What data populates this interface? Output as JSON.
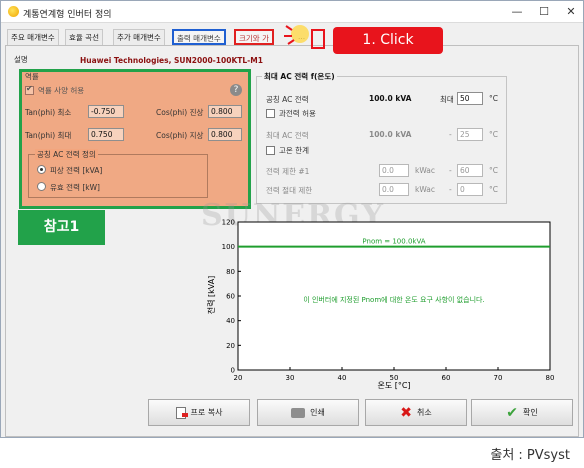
{
  "window": {
    "title": "계통연계형 인버터 정의",
    "controls": [
      "—",
      "☐",
      "✕"
    ]
  },
  "tabs": [
    "주요 매개변수",
    "효율 곡선",
    "추가 매개변수",
    "출력 매개변수",
    "크기와 가",
    "..."
  ],
  "description": {
    "label": "설명",
    "value": "Huawei Technologies, SUN2000-100KTL-M1"
  },
  "reactive": {
    "section": "역률",
    "allow_label": "역률 사양 허용",
    "tanphi_min_label": "Tan(phi) 최소",
    "tanphi_min": "-0.750",
    "cosphi_lead_label": "Cos(phi) 진상",
    "cosphi_lead": "0.800",
    "tanphi_max_label": "Tan(phi) 최대",
    "tanphi_max": "0.750",
    "cosphi_lag_label": "Cos(phi) 지상",
    "cosphi_lag": "0.800",
    "group_title": "공칭 AC 전력 정의",
    "option_apparent": "피상 전력 [kVA]",
    "option_active": "유효 전력 [kW]"
  },
  "ac_power": {
    "title": "최대 AC 전력 f(온도)",
    "nominal_label": "공칭 AC 전력",
    "nominal_value": "100.0 kVA",
    "max_label": "최대",
    "max_temp": "50",
    "unit_c": "°C",
    "overpower_label": "과전력 허용",
    "max_ac_label": "최대 AC 전력",
    "max_ac_value": "100.0 kVA",
    "max_ac_temp": "25",
    "high_temp_label": "고온 한계",
    "limit1_label": "전력 제한 #1",
    "limit1_value": "0.0",
    "limit1_unit": "kWac",
    "limit1_temp": "60",
    "abs_limit_label": "전력 절대 제한",
    "abs_limit_value": "0.0",
    "abs_limit_unit": "kWac",
    "abs_limit_temp": "0",
    "dash": "-"
  },
  "chart_data": {
    "type": "line",
    "xlabel": "온도 [°C]",
    "ylabel": "전력 [kVA]",
    "xlim": [
      20,
      80
    ],
    "ylim": [
      0,
      120
    ],
    "xticks": [
      20,
      30,
      40,
      50,
      60,
      70,
      80
    ],
    "yticks": [
      0,
      20,
      40,
      60,
      80,
      100,
      120
    ],
    "series": [
      {
        "name": "Pnom = 100.0kVA",
        "x": [
          20,
          80
        ],
        "y": [
          100,
          100
        ],
        "color": "#1f9e2e"
      }
    ],
    "annotation": "이 인버터에 지정된 Pnom에 대한 온도 요구 사항이 없습니다."
  },
  "overlay": {
    "ref_badge": "참고1",
    "click_badge": "1. Click",
    "watermark": "SUNERGY"
  },
  "footer": {
    "print_label": "프로 복사",
    "print2_label": "인쇄",
    "cancel_label": "취소",
    "ok_label": "확인"
  },
  "source": "출처 : PVsyst"
}
